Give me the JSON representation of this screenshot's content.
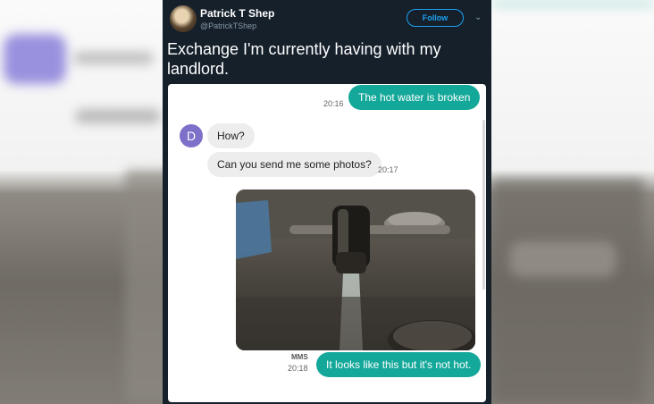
{
  "tweet": {
    "display_name": "Patrick T Shep",
    "handle": "@PatrickTShep",
    "follow_label": "Follow",
    "text": "Exchange I'm currently having with my landlord.",
    "avatar_icon": "profile-photo",
    "more_icon": "chevron-down-icon",
    "colors": {
      "background": "#15202b",
      "accent": "#1da1f2"
    }
  },
  "conversation": {
    "contact_initial": "D",
    "messages": [
      {
        "direction": "out",
        "text": "The hot water is broken",
        "time": "20:16"
      },
      {
        "direction": "in",
        "text": "How?"
      },
      {
        "direction": "in",
        "text": "Can you send me some photos?",
        "time": "20:17"
      },
      {
        "direction": "out",
        "type": "image",
        "label": "MMS",
        "time": "20:18"
      },
      {
        "direction": "out",
        "text": "It looks like this but it's not hot."
      }
    ],
    "colors": {
      "outgoing": "#14a89a",
      "incoming": "#ededed",
      "avatar": "#7d70c9"
    }
  }
}
